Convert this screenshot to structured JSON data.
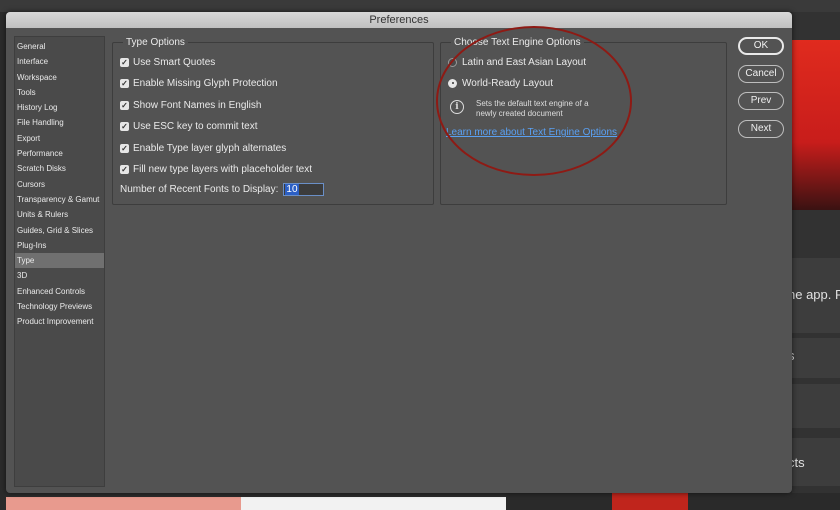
{
  "background": {
    "right_text_1": "he app. Pic",
    "right_text_2": "s",
    "right_text_3": "cts"
  },
  "dialog": {
    "title": "Preferences",
    "sidebar": {
      "items": [
        {
          "label": "General"
        },
        {
          "label": "Interface"
        },
        {
          "label": "Workspace"
        },
        {
          "label": "Tools"
        },
        {
          "label": "History Log"
        },
        {
          "label": "File Handling"
        },
        {
          "label": "Export"
        },
        {
          "label": "Performance"
        },
        {
          "label": "Scratch Disks"
        },
        {
          "label": "Cursors"
        },
        {
          "label": "Transparency & Gamut"
        },
        {
          "label": "Units & Rulers"
        },
        {
          "label": "Guides, Grid & Slices"
        },
        {
          "label": "Plug-Ins"
        },
        {
          "label": "Type"
        },
        {
          "label": "3D"
        },
        {
          "label": "Enhanced Controls"
        },
        {
          "label": "Technology Previews"
        },
        {
          "label": "Product Improvement"
        }
      ],
      "selected": "Type"
    },
    "type_options": {
      "title": "Type Options",
      "checkboxes": [
        {
          "label": "Use Smart Quotes",
          "checked": true
        },
        {
          "label": "Enable Missing Glyph Protection",
          "checked": true
        },
        {
          "label": "Show Font Names in English",
          "checked": true
        },
        {
          "label": "Use ESC key to commit text",
          "checked": true
        },
        {
          "label": "Enable Type layer glyph alternates",
          "checked": true
        },
        {
          "label": "Fill new type layers with placeholder text",
          "checked": true
        }
      ],
      "recent_fonts_label": "Number of Recent Fonts to Display:",
      "recent_fonts_value": "10"
    },
    "text_engine": {
      "title": "Choose Text Engine Options",
      "options": [
        {
          "label": "Latin and East Asian Layout",
          "selected": false
        },
        {
          "label": "World-Ready Layout",
          "selected": true
        }
      ],
      "info_text": "Sets the default text engine of a newly created document",
      "learn_more": "Learn more about Text Engine Options"
    },
    "buttons": {
      "ok": "OK",
      "cancel": "Cancel",
      "prev": "Prev",
      "next": "Next"
    }
  },
  "colors": {
    "dialog_bg": "#535353",
    "link": "#5aa0f2",
    "annotation": "#8e1a14",
    "selection": "#707070"
  }
}
